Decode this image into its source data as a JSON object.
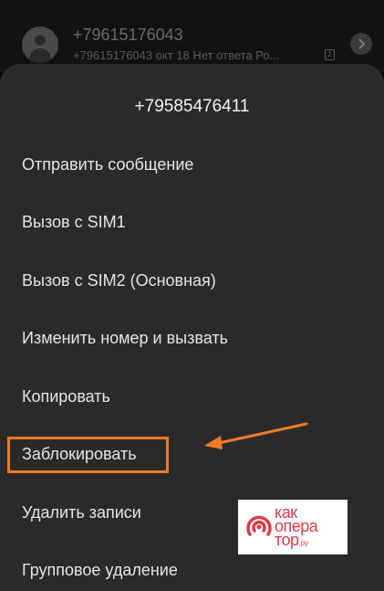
{
  "background_row": {
    "number": "+79615176043",
    "subtitle": "+79615176043 окт 18 Нет ответа Ро...",
    "sim_badge": "2",
    "avatar_icon": "person-icon",
    "chevron_icon": "chevron-right-icon"
  },
  "sheet": {
    "title": "+79585476411",
    "items": [
      {
        "label": "Отправить сообщение"
      },
      {
        "label": "Вызов с SIM1"
      },
      {
        "label": "Вызов с SIM2 (Основная)"
      },
      {
        "label": "Изменить номер и вызвать"
      },
      {
        "label": "Копировать"
      },
      {
        "label": "Заблокировать"
      },
      {
        "label": "Удалить записи"
      },
      {
        "label": "Групповое удаление"
      }
    ]
  },
  "annotation": {
    "highlight_color": "#f07b26",
    "arrow_color": "#f07b26",
    "highlighted_item": "Заблокировать"
  },
  "watermark": {
    "line1": "как",
    "line2": "опера",
    "line3": "тор",
    "suffix": ".ру",
    "color": "#e03a48"
  }
}
